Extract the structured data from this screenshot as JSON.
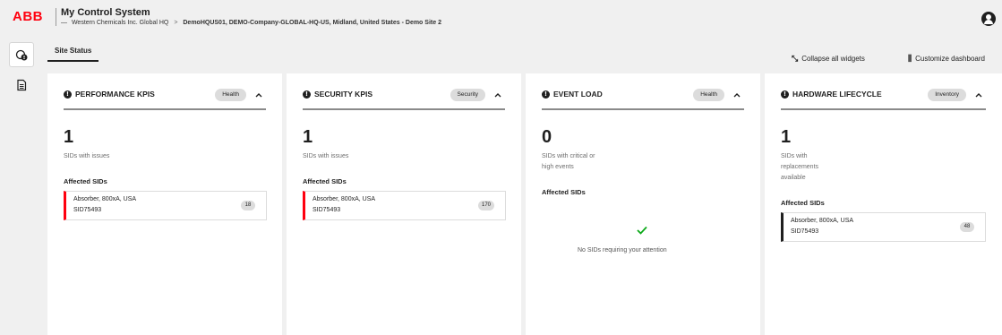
{
  "header": {
    "logo": "ABB",
    "app_title": "My Control System",
    "breadcrumb": {
      "dash": "—",
      "org": "Western Chemicals Inc. Global HQ",
      "sep": ">",
      "site": "DemoHQUS01, DEMO-Company-GLOBAL-HQ-US, Midland, United States - Demo Site 2"
    },
    "user_icon": "user-avatar-icon"
  },
  "sidebar": {
    "items": [
      {
        "icon": "site-status-icon",
        "active": true
      },
      {
        "icon": "document-icon",
        "active": false
      }
    ]
  },
  "tabs": [
    {
      "label": "Site Status",
      "active": true
    }
  ],
  "toolbar": {
    "collapse_label": "Collapse all widgets",
    "customize_label": "Customize dashboard"
  },
  "widgets": [
    {
      "title": "PERFORMANCE KPIS",
      "tag": "Health",
      "count": "1",
      "subtext_lines": [
        "SIDs with issues"
      ],
      "affected_label": "Affected SIDs",
      "items": [
        {
          "name": "Absorber, 800xA, USA",
          "sid": "SID75493",
          "count": "18"
        }
      ]
    },
    {
      "title": "SECURITY KPIS",
      "tag": "Security",
      "count": "1",
      "subtext_lines": [
        "SIDs with issues"
      ],
      "affected_label": "Affected SIDs",
      "items": [
        {
          "name": "Absorber, 800xA, USA",
          "sid": "SID75493",
          "count": "170"
        }
      ]
    },
    {
      "title": "EVENT LOAD",
      "tag": "Health",
      "count": "0",
      "subtext_lines": [
        "SIDs with critical or",
        "high events"
      ],
      "affected_label": "Affected SIDs",
      "empty_message": "No SIDs requiring your attention",
      "items": []
    },
    {
      "title": "HARDWARE LIFECYCLE",
      "tag": "Inventory",
      "count": "1",
      "subtext_lines": [
        "SIDs with",
        "replacements",
        "available"
      ],
      "affected_label": "Affected SIDs",
      "items": [
        {
          "name": "Absorber, 800xA, USA",
          "sid": "SID75493",
          "count": "48"
        }
      ]
    }
  ],
  "colors": {
    "brand_red": "#ff000f",
    "success_green": "#0ca919",
    "background": "#f0f0f0"
  }
}
